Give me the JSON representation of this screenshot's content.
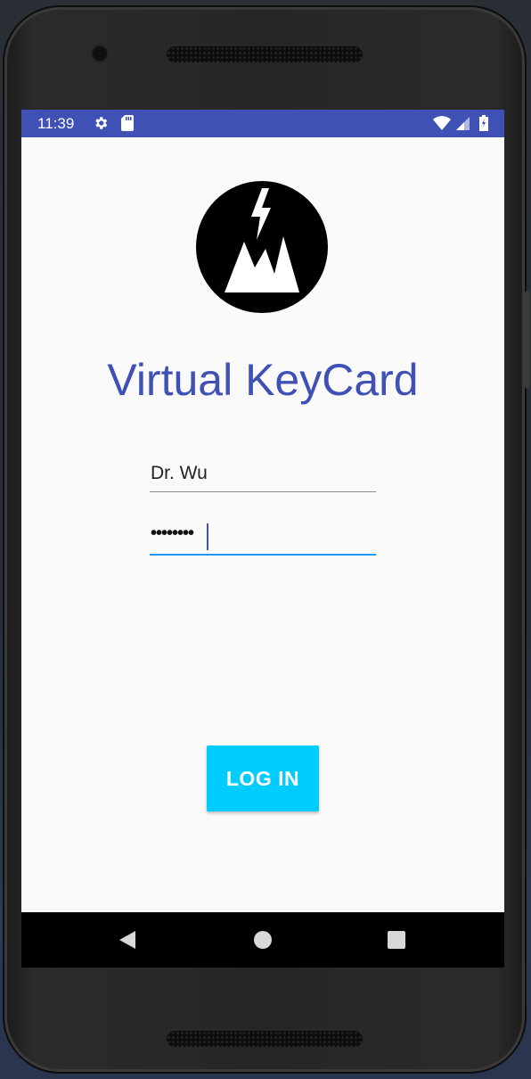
{
  "status_bar": {
    "time": "11:39",
    "bg_color": "#3f51b5",
    "left_icons": [
      "gear-icon",
      "sd-card-icon"
    ],
    "right_icons": [
      "wifi-icon",
      "cell-signal-icon",
      "battery-icon"
    ]
  },
  "app": {
    "logo_icon": "mountain-lightning-logo",
    "title": "Virtual KeyCard",
    "title_color": "#3f51b5"
  },
  "form": {
    "username_value": "Dr. Wu",
    "password_masked": "••••••••",
    "password_focused": true,
    "accent_color": "#2196f3"
  },
  "actions": {
    "login_label": "LOG IN",
    "login_color": "#00ccff"
  },
  "nav_bar": {
    "buttons": [
      "back-icon",
      "home-icon",
      "recents-icon"
    ]
  }
}
